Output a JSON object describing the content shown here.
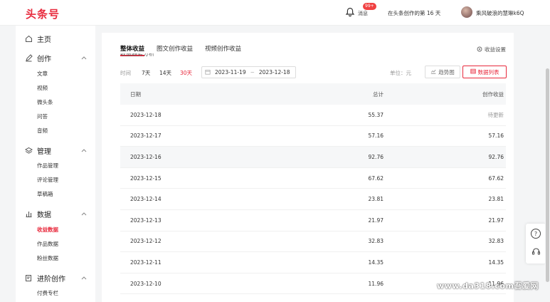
{
  "header": {
    "logo": "头条号",
    "messages_label": "消息",
    "messages_badge": "99+",
    "creation_days": "在头条创作的第 16 天",
    "username": "乘风破浪的慧琳k6Q"
  },
  "sidebar": {
    "groups": [
      {
        "label": "主页",
        "icon": "home-icon",
        "items": []
      },
      {
        "label": "创作",
        "icon": "pen-icon",
        "items": [
          "文章",
          "视频",
          "微头条",
          "问答",
          "音频"
        ]
      },
      {
        "label": "管理",
        "icon": "layers-icon",
        "items": [
          "作品管理",
          "评论管理",
          "草稿箱"
        ]
      },
      {
        "label": "数据",
        "icon": "bar-chart-icon",
        "items": [
          "收益数据",
          "作品数据",
          "粉丝数据"
        ]
      },
      {
        "label": "进阶创作",
        "icon": "edit-doc-icon",
        "items": [
          "付费专栏"
        ]
      }
    ],
    "active_item": "收益数据"
  },
  "main": {
    "tabs": [
      "整体收益",
      "图文创作收益",
      "视频创作收益"
    ],
    "active_tab": "整体收益",
    "subtitle": "收益趋势分析",
    "income_settings": "收益设置",
    "filter": {
      "time_label": "时间",
      "options": [
        "7天",
        "14天",
        "30天"
      ],
      "selected": "30天",
      "date_start": "2023-11-19",
      "date_sep": "~",
      "date_end": "2023-12-18",
      "unit_label": "单位：元",
      "trend_button": "趋势图",
      "list_button": "数据列表"
    },
    "table": {
      "columns": [
        "日期",
        "总计",
        "创作收益"
      ],
      "rows": [
        {
          "date": "2023-12-18",
          "total": "55.37",
          "creation": "待更新"
        },
        {
          "date": "2023-12-17",
          "total": "57.16",
          "creation": "57.16"
        },
        {
          "date": "2023-12-16",
          "total": "92.76",
          "creation": "92.76"
        },
        {
          "date": "2023-12-15",
          "total": "67.62",
          "creation": "67.62"
        },
        {
          "date": "2023-12-14",
          "total": "23.81",
          "creation": "23.81"
        },
        {
          "date": "2023-12-13",
          "total": "21.97",
          "creation": "21.97"
        },
        {
          "date": "2023-12-12",
          "total": "32.83",
          "creation": "32.83"
        },
        {
          "date": "2023-12-11",
          "total": "14.35",
          "creation": "14.35"
        },
        {
          "date": "2023-12-10",
          "total": "11.96",
          "creation": "11.96"
        }
      ]
    }
  },
  "float": {
    "help_glyph": "?",
    "service_glyph": "☊"
  },
  "watermark": "www.da318.com吾爱网",
  "colors": {
    "accent": "#e8293c",
    "badge": "#f04142",
    "page_bg": "#f4f5f6"
  }
}
